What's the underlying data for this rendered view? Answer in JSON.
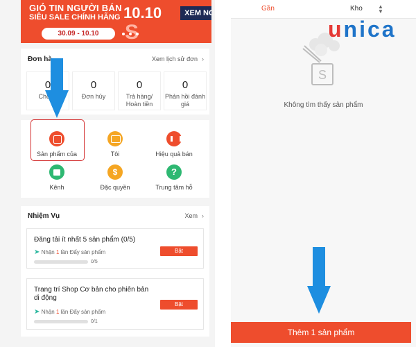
{
  "banner": {
    "line1": "GIỎ TIN NGƯỜI BÁN",
    "line2": "SIÊU SALE CHÍNH HÃNG",
    "number": "10.10",
    "cta": "XEM NGAY",
    "dates": "30.09 - 10.10"
  },
  "orders": {
    "title": "Đơn hà",
    "history_link": "Xem lịch sử đơn",
    "stats": [
      {
        "value": "0",
        "label": "Chờ lấ"
      },
      {
        "value": "0",
        "label": "Đơn hủy"
      },
      {
        "value": "0",
        "label": "Trả hàng/ Hoàn tiền"
      },
      {
        "value": "0",
        "label": "Phản hồi đánh giá"
      }
    ]
  },
  "menu": {
    "items": [
      {
        "label": "Sản phẩm của",
        "icon": "product-box-icon"
      },
      {
        "label": "Tôi",
        "icon": "wallet-icon"
      },
      {
        "label": "Hiệu quả bán",
        "icon": "sales-chart-icon"
      },
      {
        "label": "Kênh",
        "icon": "shop-channel-icon"
      },
      {
        "label": "Đặc quyền",
        "icon": "privilege-bag-icon"
      },
      {
        "label": "Trung tâm hỗ",
        "icon": "help-center-icon"
      }
    ]
  },
  "tasks": {
    "title": "Nhiệm Vụ",
    "view_link": "Xem",
    "items": [
      {
        "title": "Đăng tải ít nhất 5 sản phẩm (0/5)",
        "reward_prefix": "Nhận",
        "reward_count": "1",
        "reward_suffix": "lần Đẩy sản phẩm",
        "button": "Bật",
        "progress": "0/5",
        "fraction": 0
      },
      {
        "title": "Trang trí Shop Cơ bản cho phiên bản di động",
        "reward_prefix": "Nhận",
        "reward_count": "1",
        "reward_suffix": "lần Đẩy sản phẩm",
        "button": "Bật",
        "progress": "0/1",
        "fraction": 0
      }
    ]
  },
  "right_panel": {
    "tab_near": "Gần",
    "tab_stock": "Kho",
    "empty_message": "Không tìm thấy sản phẩm",
    "empty_icon": "empty-bag-icon",
    "add_button": "Thêm 1 sản phẩm"
  },
  "watermark": {
    "part1": "u",
    "part2": "nica"
  },
  "colors": {
    "accent": "#ee4d2d",
    "arrow": "#1e8ee0",
    "highlight": "#d32f2f",
    "brand_red": "#e53935",
    "brand_blue": "#1f74c9"
  }
}
